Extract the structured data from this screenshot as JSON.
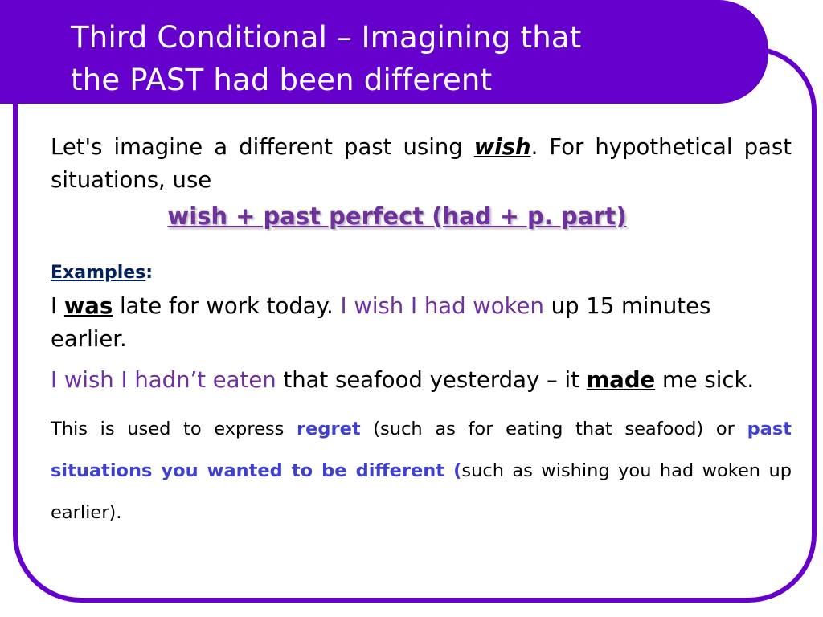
{
  "slide": {
    "title_line1": "Third Conditional – Imagining that",
    "title_line2": "the PAST had been different",
    "intro": {
      "before_keyword": "Let's imagine a different past using ",
      "keyword": "wish",
      "after_keyword": ". For hypothetical past situations, use"
    },
    "formula": "wish + past perfect (had + p. part)",
    "examples_label": "Examples",
    "examples_colon": ":",
    "example1": {
      "part1": "I ",
      "emphasis": "was",
      "part2": " late for work today. ",
      "wish": "I wish I had woken",
      "part3": " up 15 minutes earlier."
    },
    "example2": {
      "wish": "I wish I hadn’t eaten",
      "part1": " that seafood yesterday – it ",
      "emphasis": "made",
      "part2": " me sick."
    },
    "note": {
      "part1": "This is used to express ",
      "highlight1": "regret",
      "part2": " (such as for eating that seafood) or ",
      "highlight2": "past situations you wanted to be different (",
      "part3": "such as wishing you had woken up earlier)."
    },
    "colors": {
      "banner": "#6600cc",
      "formula": "#7030a0",
      "examples_label": "#002060",
      "wish_phrase": "#7030a0",
      "note_highlight": "#3f3fd0"
    }
  }
}
